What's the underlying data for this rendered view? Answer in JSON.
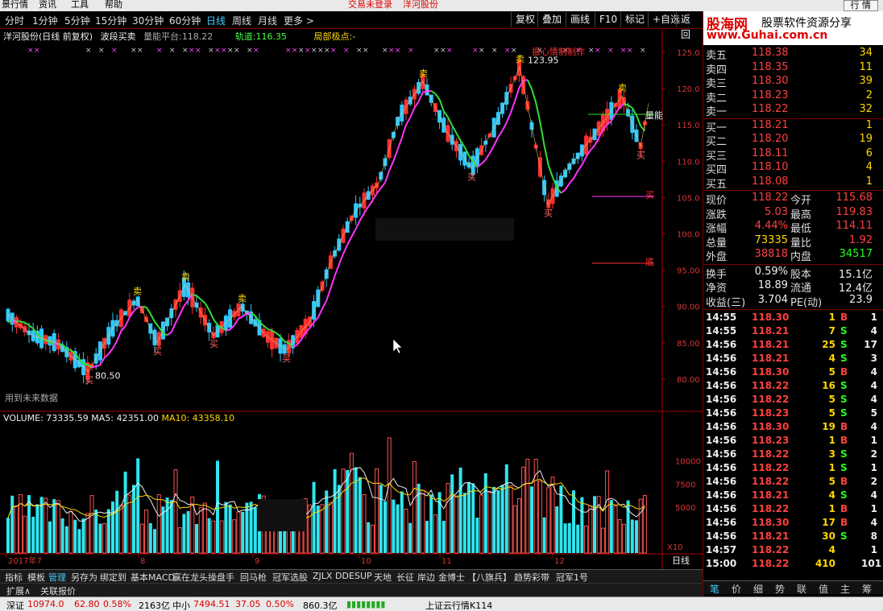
{
  "menubar": {
    "items": [
      "景行情",
      "资讯",
      "工具",
      "帮助"
    ],
    "login": "交易未登录",
    "stock": "洋河股份",
    "right_tab": "行 情"
  },
  "periods": [
    "分时",
    "1分钟",
    "5分钟",
    "15分钟",
    "30分钟",
    "60分钟",
    "日线",
    "周线",
    "月线",
    "更多 >"
  ],
  "active_period": "日线",
  "toolbar_buttons": [
    "复权",
    "叠加",
    "画线",
    "F10",
    "标记",
    "+自选",
    "返回"
  ],
  "info": {
    "title": "洋河股份(日线 前复权)",
    "indicator": "波段买卖",
    "energy_label": "量能平台:",
    "energy_value": "118.22",
    "track_label": "轨道:",
    "track_value": "116.35",
    "pole_label": "局部极点:",
    "pole_value": "-",
    "author": "振心情制制作",
    "future": "用到未来数据"
  },
  "price_axis": [
    "125.0",
    "120.0",
    "115.0",
    "110.0",
    "105.0",
    "100.0",
    "95.00",
    "90.00",
    "85.00",
    "80.00"
  ],
  "chart_labels": {
    "high": "123.95",
    "low": "80.50",
    "buy": "买",
    "sell": "卖",
    "energy": "量能",
    "stop": "底"
  },
  "volume": {
    "label": "VOLUME: 73335.59",
    "ma5": "MA5: 42351.00",
    "ma10": "MA10: 43358.10",
    "axis": [
      "10000",
      "7500",
      "5000"
    ],
    "unit": "X10"
  },
  "date_axis": [
    "2017年7",
    "8",
    "9",
    "10",
    "11",
    "12"
  ],
  "period_label": "日线",
  "order_book": {
    "asks": [
      {
        "label": "卖五",
        "price": "118.38",
        "vol": "34"
      },
      {
        "label": "卖四",
        "price": "118.35",
        "vol": "11"
      },
      {
        "label": "卖三",
        "price": "118.30",
        "vol": "39"
      },
      {
        "label": "卖二",
        "price": "118.23",
        "vol": "2"
      },
      {
        "label": "卖一",
        "price": "118.22",
        "vol": "32"
      }
    ],
    "bids": [
      {
        "label": "买一",
        "price": "118.21",
        "vol": "1"
      },
      {
        "label": "买二",
        "price": "118.20",
        "vol": "19"
      },
      {
        "label": "买三",
        "price": "118.11",
        "vol": "6"
      },
      {
        "label": "买四",
        "price": "118.10",
        "vol": "4"
      },
      {
        "label": "买五",
        "price": "118.08",
        "vol": "1"
      }
    ]
  },
  "stats": [
    {
      "l1": "现价",
      "v1": "118.22",
      "c1": "red",
      "l2": "今开",
      "v2": "115.68",
      "c2": "red"
    },
    {
      "l1": "涨跌",
      "v1": "5.03",
      "c1": "red",
      "l2": "最高",
      "v2": "119.83",
      "c2": "red"
    },
    {
      "l1": "涨幅",
      "v1": "4.44%",
      "c1": "red",
      "l2": "最低",
      "v2": "114.11",
      "c2": "red"
    },
    {
      "l1": "总量",
      "v1": "73335",
      "c1": "yellow",
      "l2": "量比",
      "v2": "1.92",
      "c2": "red"
    },
    {
      "l1": "外盘",
      "v1": "38818",
      "c1": "red",
      "l2": "内盘",
      "v2": "34517",
      "c2": "green"
    }
  ],
  "stats2": [
    {
      "l1": "换手",
      "v1": "0.59%",
      "l2": "股本",
      "v2": "15.1亿"
    },
    {
      "l1": "净资",
      "v1": "18.89",
      "l2": "流通",
      "v2": "12.4亿"
    },
    {
      "l1": "收益(三)",
      "v1": "3.704",
      "l2": "PE(动)",
      "v2": "23.9"
    }
  ],
  "ticks": [
    {
      "t": "14:55",
      "p": "118.30",
      "v": "1",
      "s": "B",
      "n": "1"
    },
    {
      "t": "14:55",
      "p": "118.21",
      "v": "7",
      "s": "S",
      "n": "4"
    },
    {
      "t": "14:56",
      "p": "118.21",
      "v": "25",
      "s": "S",
      "n": "17"
    },
    {
      "t": "14:56",
      "p": "118.21",
      "v": "4",
      "s": "S",
      "n": "3"
    },
    {
      "t": "14:56",
      "p": "118.30",
      "v": "5",
      "s": "B",
      "n": "4"
    },
    {
      "t": "14:56",
      "p": "118.22",
      "v": "16",
      "s": "S",
      "n": "4"
    },
    {
      "t": "14:56",
      "p": "118.22",
      "v": "5",
      "s": "S",
      "n": "4"
    },
    {
      "t": "14:56",
      "p": "118.23",
      "v": "5",
      "s": "S",
      "n": "5"
    },
    {
      "t": "14:56",
      "p": "118.30",
      "v": "19",
      "s": "B",
      "n": "4"
    },
    {
      "t": "14:56",
      "p": "118.23",
      "v": "1",
      "s": "B",
      "n": "1"
    },
    {
      "t": "14:56",
      "p": "118.22",
      "v": "3",
      "s": "S",
      "n": "2"
    },
    {
      "t": "14:56",
      "p": "118.22",
      "v": "1",
      "s": "S",
      "n": "1"
    },
    {
      "t": "14:56",
      "p": "118.22",
      "v": "5",
      "s": "B",
      "n": "2"
    },
    {
      "t": "14:56",
      "p": "118.21",
      "v": "4",
      "s": "S",
      "n": "4"
    },
    {
      "t": "14:56",
      "p": "118.22",
      "v": "1",
      "s": "B",
      "n": "1"
    },
    {
      "t": "14:56",
      "p": "118.30",
      "v": "17",
      "s": "B",
      "n": "4"
    },
    {
      "t": "14:56",
      "p": "118.21",
      "v": "30",
      "s": "S",
      "n": "8"
    },
    {
      "t": "14:57",
      "p": "118.22",
      "v": "4",
      "s": "",
      "n": "1"
    },
    {
      "t": "15:00",
      "p": "118.22",
      "v": "410",
      "s": "",
      "n": "101"
    }
  ],
  "right_tabs": [
    "笔",
    "价",
    "细",
    "势",
    "联",
    "值",
    "主",
    "筹"
  ],
  "bottom_tabs": [
    "指标",
    "模板",
    "管理",
    "另存为",
    "绑定到",
    "基本MACD",
    "赢在龙头",
    "操盘手",
    "回马枪",
    "冠军选股",
    "ZJLX",
    "DDE",
    "SUP",
    "天地",
    "长征",
    "岸边",
    "金博士",
    "【八旗兵】",
    "趋势彩带",
    "冠军1号"
  ],
  "active_bottom_tab": "管理",
  "bottom_tabs2": [
    "扩展∧",
    "关联报价"
  ],
  "status": {
    "sh_label": "深证",
    "sh_val": "10974.0",
    "sh_chg": "62.80",
    "sh_pct": "0.58%",
    "sh_amt": "2163亿",
    "zx_label": "中小",
    "zx_val": "7494.51",
    "zx_chg": "37.05",
    "zx_pct": "0.50%",
    "zx_amt": "860.3亿",
    "cloud": "上证云行情K114"
  },
  "logo": {
    "name": "股海网",
    "slogan": "股票软件资源分享",
    "url": "www.Guhai.com.cn"
  }
}
